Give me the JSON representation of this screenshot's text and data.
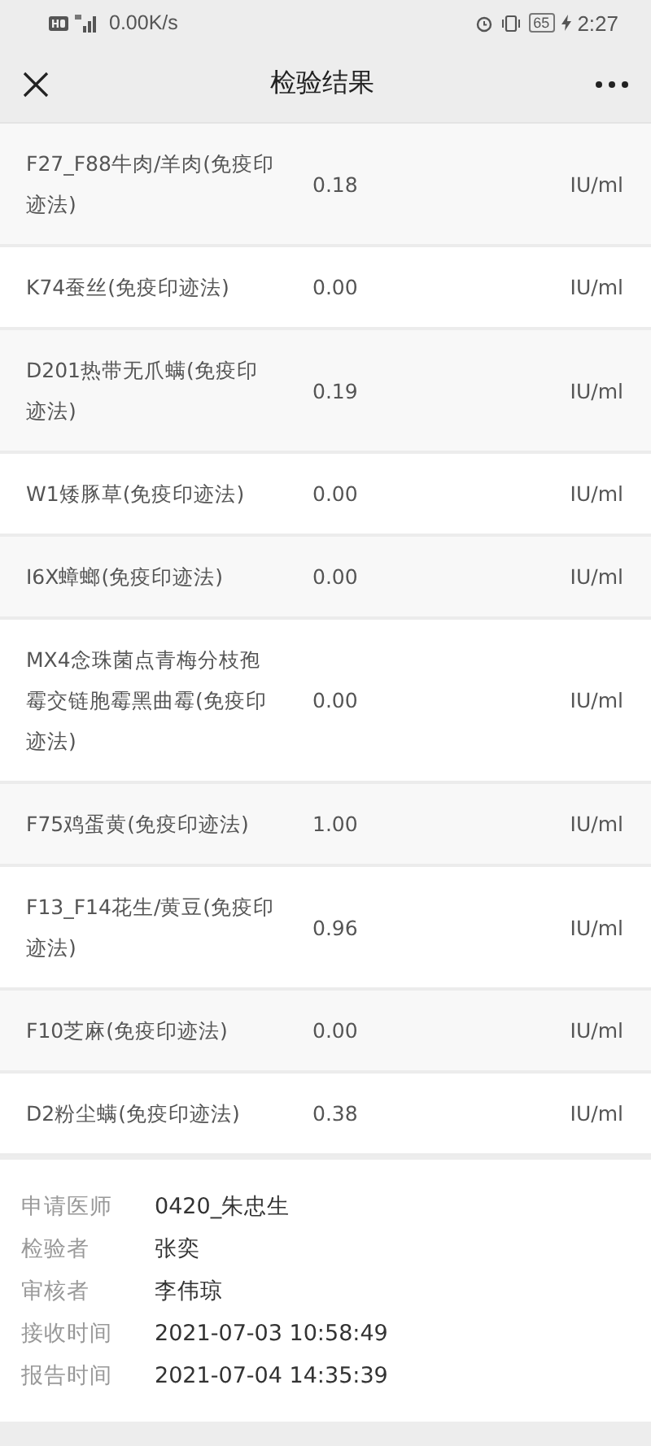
{
  "status_bar": {
    "speed": "0.00K/s",
    "battery": "65",
    "time": "2:27"
  },
  "nav": {
    "title": "检验结果"
  },
  "results": [
    {
      "name": "F27_F88牛肉/羊肉(免疫印迹法)",
      "value": "0.18",
      "unit": "IU/ml"
    },
    {
      "name": "K74蚕丝(免疫印迹法)",
      "value": "0.00",
      "unit": "IU/ml"
    },
    {
      "name": "D201热带无爪螨(免疫印迹法)",
      "value": "0.19",
      "unit": "IU/ml"
    },
    {
      "name": "W1矮豚草(免疫印迹法)",
      "value": "0.00",
      "unit": "IU/ml"
    },
    {
      "name": "I6X蟑螂(免疫印迹法)",
      "value": "0.00",
      "unit": "IU/ml"
    },
    {
      "name": "MX4念珠菌点青梅分枝孢霉交链胞霉黑曲霉(免疫印迹法)",
      "value": "0.00",
      "unit": "IU/ml"
    },
    {
      "name": "F75鸡蛋黄(免疫印迹法)",
      "value": "1.00",
      "unit": "IU/ml"
    },
    {
      "name": "F13_F14花生/黄豆(免疫印迹法)",
      "value": "0.96",
      "unit": "IU/ml"
    },
    {
      "name": "F10芝麻(免疫印迹法)",
      "value": "0.00",
      "unit": "IU/ml"
    },
    {
      "name": "D2粉尘螨(免疫印迹法)",
      "value": "0.38",
      "unit": "IU/ml"
    }
  ],
  "info": [
    {
      "label": "申请医师",
      "value": "0420_朱忠生"
    },
    {
      "label": "检验者",
      "value": "张奕"
    },
    {
      "label": "审核者",
      "value": "李伟琼"
    },
    {
      "label": "接收时间",
      "value": "2021-07-03 10:58:49"
    },
    {
      "label": "报告时间",
      "value": "2021-07-04 14:35:39"
    }
  ]
}
